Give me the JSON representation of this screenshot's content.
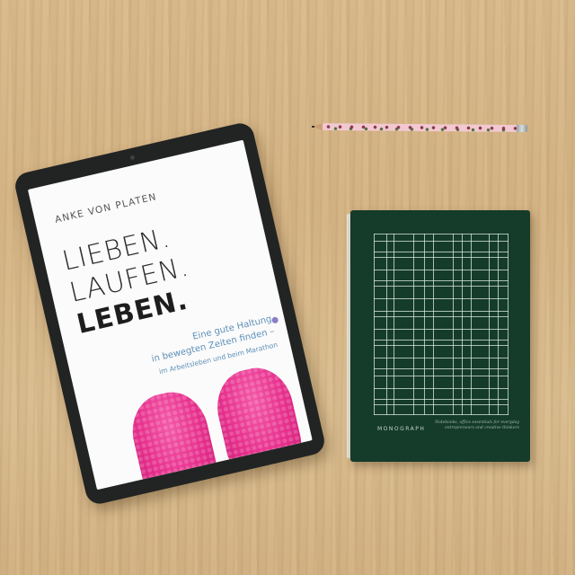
{
  "book_cover": {
    "author": "ANKE VON PLATEN",
    "title_line_1": "LIEBEN.",
    "title_line_2": "LAUFEN.",
    "title_line_3": "LEBEN.",
    "subtitle_line_1": "Eine gute Haltung",
    "subtitle_line_2": "in bewegten Zeiten finden –",
    "subtitle_line_3": "im Arbeitsleben und beim Marathon"
  },
  "notebook": {
    "brand": "MONOGRAPH",
    "tagline_line_1": "Notebooks, office essentials for everyday",
    "tagline_line_2": "entrepreneurs and creative thinkers"
  },
  "colors": {
    "wood": "#d6b585",
    "tablet_bezel": "#222423",
    "shoe_pink": "#e7308d",
    "subtitle_blue": "#5c8fb7",
    "notebook_green": "#153b2b",
    "pencil_pink": "#f2c9d2"
  },
  "icons": [
    "tablet-camera-icon",
    "page-marker-icon"
  ]
}
